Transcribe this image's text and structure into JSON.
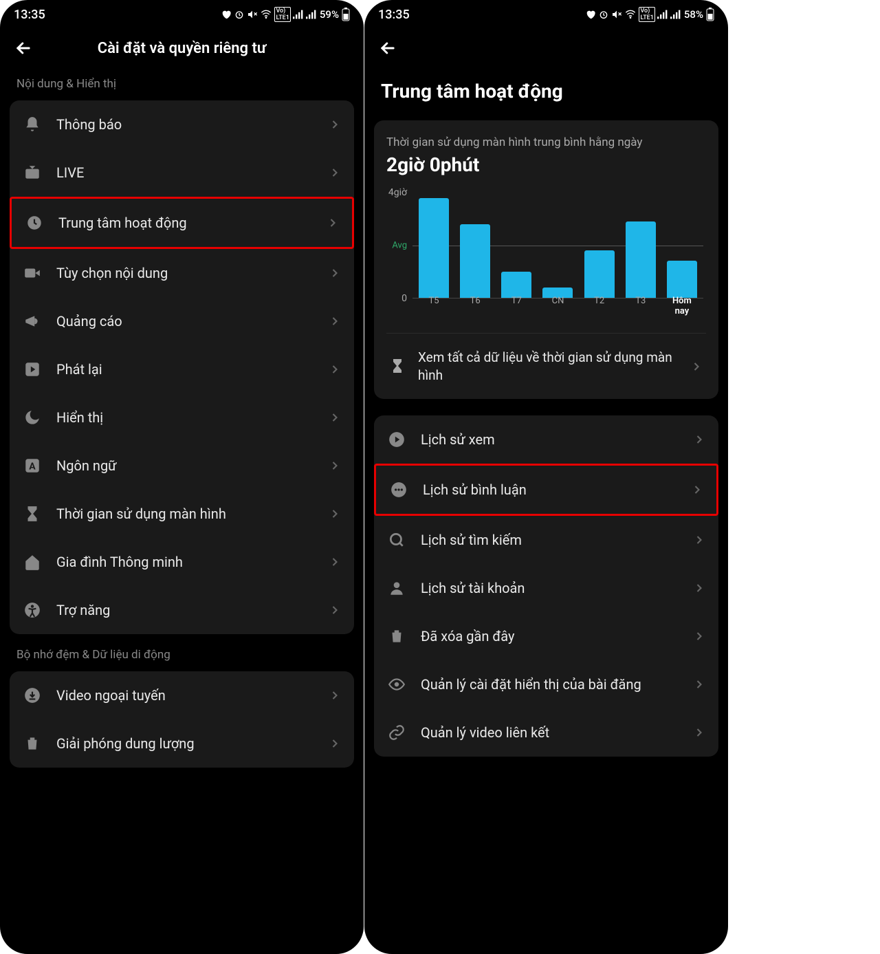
{
  "left": {
    "status": {
      "time": "13:35",
      "battery": "59%"
    },
    "header": {
      "title": "Cài đặt và quyền riêng tư"
    },
    "section1_label": "Nội dung & Hiển thị",
    "items1": [
      {
        "icon": "bell",
        "label": "Thông báo",
        "highlight": false
      },
      {
        "icon": "tv",
        "label": "LIVE",
        "highlight": false
      },
      {
        "icon": "clock",
        "label": "Trung tâm hoạt động",
        "highlight": true
      },
      {
        "icon": "video",
        "label": "Tùy chọn nội dung",
        "highlight": false
      },
      {
        "icon": "megaphone",
        "label": "Quảng cáo",
        "highlight": false
      },
      {
        "icon": "play-square",
        "label": "Phát lại",
        "highlight": false
      },
      {
        "icon": "moon",
        "label": "Hiển thị",
        "highlight": false
      },
      {
        "icon": "lang",
        "label": "Ngôn ngữ",
        "highlight": false
      },
      {
        "icon": "hourglass",
        "label": "Thời gian sử dụng màn hình",
        "highlight": false
      },
      {
        "icon": "home",
        "label": "Gia đình Thông minh",
        "highlight": false
      },
      {
        "icon": "accessibility",
        "label": "Trợ năng",
        "highlight": false
      }
    ],
    "section2_label": "Bộ nhớ đệm & Dữ liệu di động",
    "items2": [
      {
        "icon": "download",
        "label": "Video ngoại tuyến"
      },
      {
        "icon": "trash",
        "label": "Giải phóng dung lượng"
      }
    ]
  },
  "right": {
    "status": {
      "time": "13:35",
      "battery": "58%"
    },
    "page_title": "Trung tâm hoạt động",
    "chart": {
      "subtitle": "Thời gian sử dụng màn hình trung bình hằng ngày",
      "value": "2giờ 0phút",
      "ymax_label": "4giờ",
      "zero_label": "0",
      "avg_label": "Avg",
      "footer": "Xem tất cả dữ liệu về thời gian sử dụng màn hình"
    },
    "history": [
      {
        "icon": "play-circle",
        "label": "Lịch sử xem",
        "highlight": false
      },
      {
        "icon": "comment",
        "label": "Lịch sử bình luận",
        "highlight": true
      },
      {
        "icon": "search",
        "label": "Lịch sử tìm kiếm",
        "highlight": false
      },
      {
        "icon": "user",
        "label": "Lịch sử tài khoản",
        "highlight": false
      },
      {
        "icon": "trash",
        "label": "Đã xóa gần đây",
        "highlight": false
      },
      {
        "icon": "eye",
        "label": "Quản lý cài đặt hiển thị của bài đăng",
        "highlight": false
      },
      {
        "icon": "link",
        "label": "Quản lý video liên kết",
        "highlight": false
      }
    ]
  },
  "chart_data": {
    "type": "bar",
    "categories": [
      "T5",
      "T6",
      "T7",
      "CN",
      "T2",
      "T3",
      "Hôm nay"
    ],
    "values": [
      3.8,
      2.8,
      1.0,
      0.4,
      1.8,
      2.9,
      1.4
    ],
    "title": "Thời gian sử dụng màn hình trung bình hằng ngày",
    "avg": 2.0,
    "ylim": [
      0,
      4
    ],
    "ylabel": "giờ",
    "xlabel": ""
  }
}
